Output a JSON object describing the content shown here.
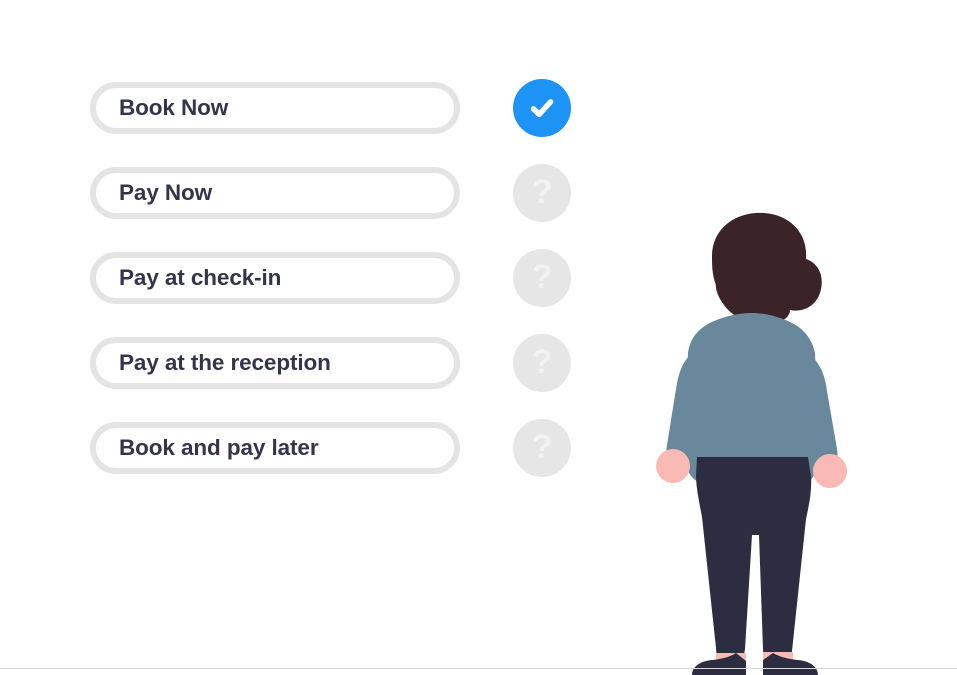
{
  "page": {
    "background_color": "#ffffff",
    "divider_color": "#d8d8d8"
  },
  "colors": {
    "accent_blue": "#1c93f5",
    "badge_gray": "#e6e6e6",
    "badge_glyph": "#f2f2f2",
    "button_border": "#e4e4e4",
    "button_fill": "#ffffff",
    "text_dark": "#33354a",
    "hair": "#3b2428",
    "skin": "#f9c3be",
    "shirt": "#6a889c",
    "pants": "#2c2d40",
    "shoes": "#2c2d40"
  },
  "options": [
    {
      "label": "Book Now",
      "status": "done",
      "status_icon": "check-icon",
      "status_glyph": ""
    },
    {
      "label": "Pay Now",
      "status": "pending",
      "status_icon": "question-mark-icon",
      "status_glyph": "?"
    },
    {
      "label": "Pay at check-in",
      "status": "pending",
      "status_icon": "question-mark-icon",
      "status_glyph": "?"
    },
    {
      "label": "Pay at the reception",
      "status": "pending",
      "status_icon": "question-mark-icon",
      "status_glyph": "?"
    },
    {
      "label": "Book and pay later",
      "status": "pending",
      "status_icon": "question-mark-icon",
      "status_glyph": "?"
    }
  ],
  "illustration": {
    "name": "person-standing-back-view",
    "description": "Flat illustration of a person seen from behind wearing a blue-gray shirt and dark navy trousers"
  }
}
